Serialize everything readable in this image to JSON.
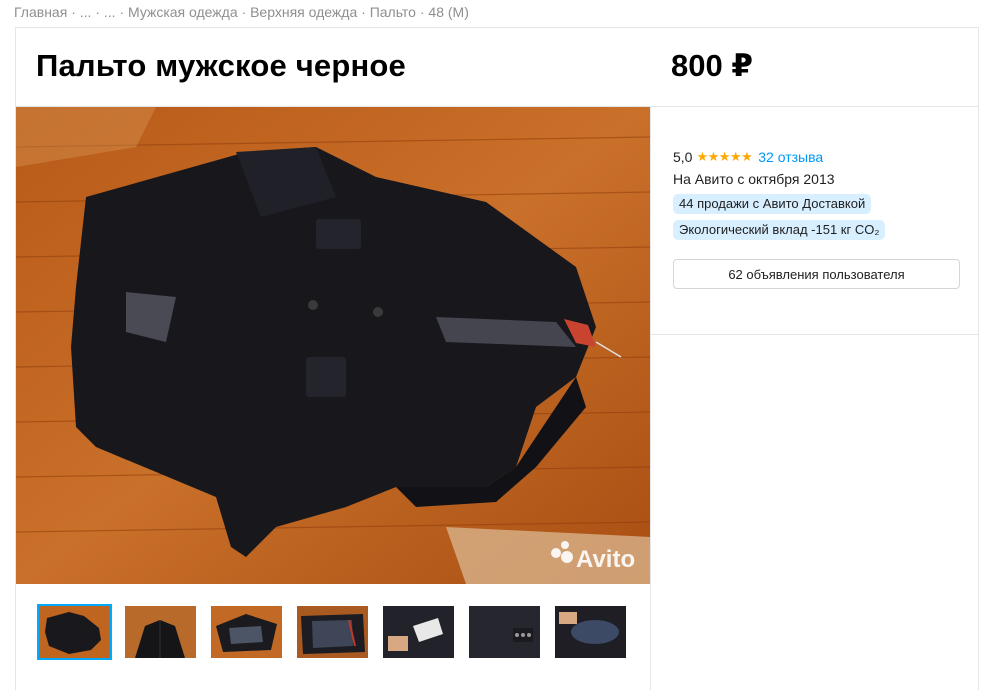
{
  "breadcrumb": {
    "items": [
      "Главная",
      "...",
      "...",
      "Мужская одежда",
      "Верхняя одежда",
      "Пальто",
      "48 (M)"
    ],
    "separator": "·"
  },
  "listing": {
    "title": "Пальто мужское черное",
    "price": "800 ₽"
  },
  "gallery": {
    "watermark": "Avito",
    "active_index": 0,
    "thumbnail_count": 7
  },
  "seller": {
    "rating": "5,0",
    "stars": "★★★★★",
    "reviews": "32 отзыва",
    "since": "На Авито с октября 2013",
    "badge_sales": "44 продажи с Авито Доставкой",
    "badge_eco": "Экологический вклад -151 кг CO₂",
    "ads_button": "62 объявления пользователя"
  },
  "colors": {
    "accent": "#0099f7",
    "star": "#ffa800",
    "badge_bg": "#d7efff",
    "floor": "#c4661e",
    "coat": "#1a1a1f"
  }
}
